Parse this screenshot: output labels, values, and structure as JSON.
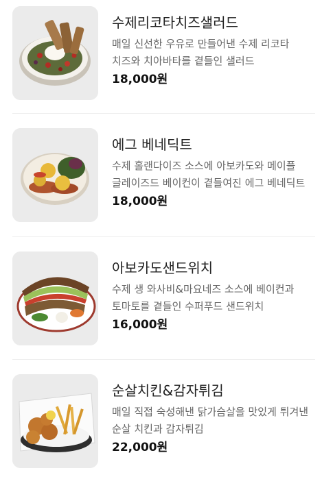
{
  "menu": {
    "items": [
      {
        "name": "수제리코타치즈샐러드",
        "description": "매일 신선한 우유로 만들어낸 수제 리코타 치즈와 치아바타를 곁들인 샐러드",
        "price": "18,000원",
        "image_icon": "salad-bowl-icon"
      },
      {
        "name": "에그 베네딕트",
        "description": "수제 홀랜다이즈 소스에 아보카도와 메이플 글레이즈드 베이컨이 곁들여진 에그 베네딕트",
        "price": "18,000원",
        "image_icon": "eggs-benedict-icon"
      },
      {
        "name": "아보카도샌드위치",
        "description": "수제 생 와사비&마요네즈 소스에 베이컨과 토마토를 곁들인 수퍼푸드 샌드위치",
        "price": "16,000원",
        "image_icon": "sandwich-icon"
      },
      {
        "name": "순살치킨&감자튀김",
        "description": "매일 직접 숙성해낸 닭가슴살을 맛있게 튀겨낸 순살 치킨과 감자튀김",
        "price": "22,000원",
        "image_icon": "fried-chicken-icon"
      }
    ]
  }
}
